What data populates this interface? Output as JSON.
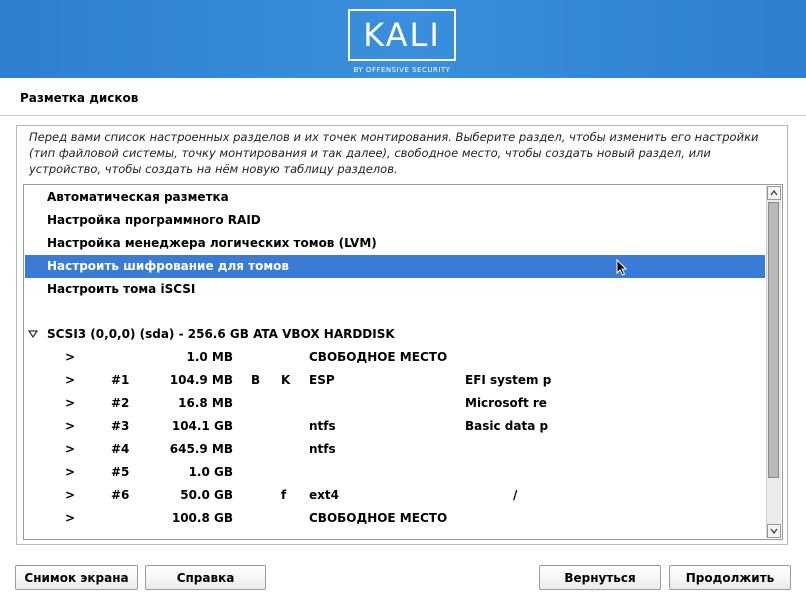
{
  "banner": {
    "logo_text": "KALI",
    "logo_subtitle": "BY OFFENSIVE SECURITY",
    "accent_color": "#3a8fdc"
  },
  "page_title": "Разметка дисков",
  "description": "Перед вами список настроенных разделов и их точек монтирования. Выберите раздел, чтобы изменить его настройки (тип файловой системы, точку монтирования и так далее), свободное место, чтобы создать новый раздел, или устройство, чтобы создать на нём новую таблицу разделов.",
  "menu_items": [
    {
      "label": "Автоматическая разметка"
    },
    {
      "label": "Настройка программного RAID"
    },
    {
      "label": "Настройка менеджера логических томов (LVM)"
    },
    {
      "label": "Настроить шифрование для томов",
      "selected": true
    },
    {
      "label": "Настроить тома iSCSI"
    }
  ],
  "selection_color": "#3a7bd5",
  "disk": {
    "toggle_icon": "triangle-down-icon",
    "label": "SCSI3 (0,0,0) (sda) - 256.6 GB ATA VBOX HARDDISK"
  },
  "partitions": [
    {
      "arrow": ">",
      "num": "",
      "size": "1.0 MB",
      "b": "",
      "k": "",
      "fs": "СВОБОДНОЕ МЕСТО",
      "name": "",
      "mount": ""
    },
    {
      "arrow": ">",
      "num": "#1",
      "size": "104.9 MB",
      "b": "B",
      "k": "K",
      "fs": "ESP",
      "name": "EFI system p",
      "mount": ""
    },
    {
      "arrow": ">",
      "num": "#2",
      "size": "16.8 MB",
      "b": "",
      "k": "",
      "fs": "",
      "name": "Microsoft re",
      "mount": ""
    },
    {
      "arrow": ">",
      "num": "#3",
      "size": "104.1 GB",
      "b": "",
      "k": "",
      "fs": "ntfs",
      "name": "Basic data p",
      "mount": ""
    },
    {
      "arrow": ">",
      "num": "#4",
      "size": "645.9 MB",
      "b": "",
      "k": "",
      "fs": "ntfs",
      "name": "",
      "mount": ""
    },
    {
      "arrow": ">",
      "num": "#5",
      "size": "1.0 GB",
      "b": "",
      "k": "",
      "fs": "",
      "name": "",
      "mount": ""
    },
    {
      "arrow": ">",
      "num": "#6",
      "size": "50.0 GB",
      "b": "",
      "k": "f",
      "fs": "ext4",
      "name": "",
      "mount": "/"
    },
    {
      "arrow": ">",
      "num": "",
      "size": "100.8 GB",
      "b": "",
      "k": "",
      "fs": "СВОБОДНОЕ МЕСТО",
      "name": "",
      "mount": ""
    }
  ],
  "buttons": {
    "screenshot": "Снимок экрана",
    "help": "Справка",
    "back": "Вернуться",
    "continue": "Продолжить"
  }
}
